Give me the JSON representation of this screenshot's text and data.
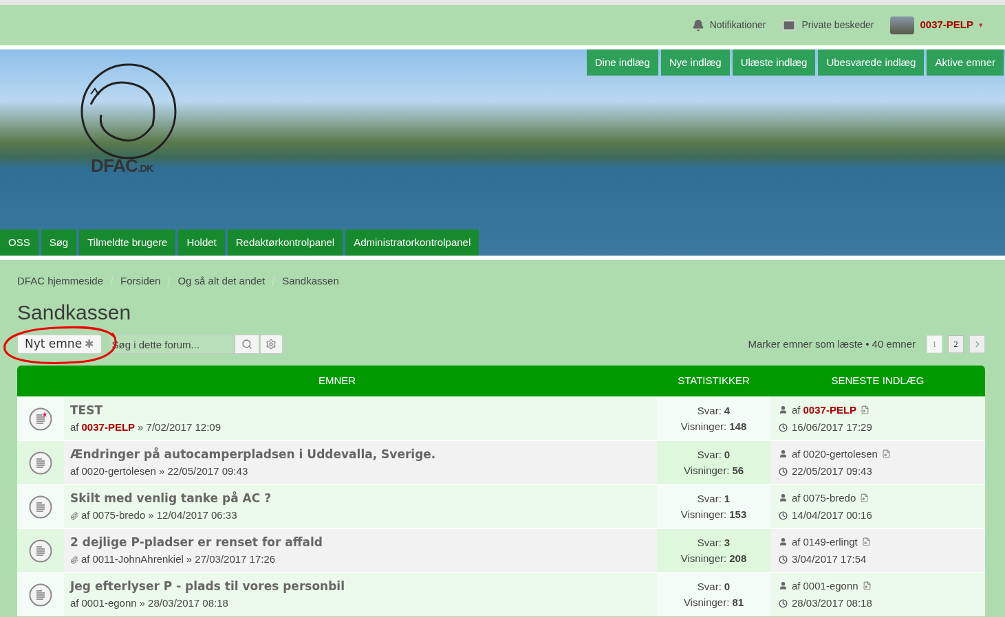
{
  "top_bar": {
    "notifications": "Notifikationer",
    "messages": "Private beskeder",
    "user": {
      "name": "0037-PELP",
      "caret": "▾"
    }
  },
  "banner": {
    "logo_text": "DFAC",
    "logo_suffix": ".DK",
    "quick_links": [
      {
        "label": "Dine indlæg"
      },
      {
        "label": "Nye indlæg"
      },
      {
        "label": "Ulæste indlæg"
      },
      {
        "label": "Ubesvarede indlæg"
      },
      {
        "label": "Aktive emner"
      }
    ],
    "nav": [
      {
        "label": "OSS"
      },
      {
        "label": "Søg"
      },
      {
        "label": "Tilmeldte brugere"
      },
      {
        "label": "Holdet"
      },
      {
        "label": "Redaktørkontrolpanel"
      },
      {
        "label": "Administratorkontrolpanel"
      }
    ]
  },
  "breadcrumbs": [
    "DFAC hjemmeside",
    "Forsiden",
    "Og så alt det andet",
    "Sandkassen"
  ],
  "title": "Sandkassen",
  "toolbar": {
    "new_topic": "Nyt emne",
    "new_topic_mark": "✱",
    "search": {
      "placeholder": "Søg i dette forum..."
    },
    "mark_read": "Marker emner som læste",
    "count": "• 40 emner",
    "pages": [
      {
        "label": "1",
        "selected": true
      },
      {
        "label": "2",
        "selected": false
      }
    ]
  },
  "table": {
    "columns": [
      "EMNER",
      "STATISTIKKER",
      "SENESTE INDLÆG"
    ],
    "rows": [
      {
        "title": "TEST",
        "unread": true,
        "attachment": false,
        "by": "af",
        "author": "0037-PELP",
        "author_highlighted": true,
        "posted": "» 7/02/2017 12:09",
        "replies_label": "Svar:",
        "replies": "4",
        "views_label": "Visninger:",
        "views": "148",
        "last_by": "af",
        "last_author": "0037-PELP",
        "last_highlighted": true,
        "last_time": "16/06/2017 17:29"
      },
      {
        "title": "Ændringer på autocamperpladsen i Uddevalla, Sverige.",
        "unread": false,
        "attachment": false,
        "by": "af",
        "author": "0020-gertolesen",
        "author_highlighted": false,
        "posted": "» 22/05/2017 09:43",
        "replies_label": "Svar:",
        "replies": "0",
        "views_label": "Visninger:",
        "views": "56",
        "last_by": "af",
        "last_author": "0020-gertolesen",
        "last_highlighted": false,
        "last_time": "22/05/2017 09:43"
      },
      {
        "title": "Skilt med venlig tanke på AC ?",
        "unread": false,
        "attachment": true,
        "by": "af",
        "author": "0075-bredo",
        "author_highlighted": false,
        "posted": "» 12/04/2017 06:33",
        "replies_label": "Svar:",
        "replies": "1",
        "views_label": "Visninger:",
        "views": "153",
        "last_by": "af",
        "last_author": "0075-bredo",
        "last_highlighted": false,
        "last_time": "14/04/2017 00:16"
      },
      {
        "title": "2 dejlige P-pladser er renset for affald",
        "unread": false,
        "attachment": true,
        "by": "af",
        "author": "0011-JohnAhrenkiel",
        "author_highlighted": false,
        "posted": "» 27/03/2017 17:26",
        "replies_label": "Svar:",
        "replies": "3",
        "views_label": "Visninger:",
        "views": "208",
        "last_by": "af",
        "last_author": "0149-erlingt",
        "last_highlighted": false,
        "last_time": "3/04/2017 17:54"
      },
      {
        "title": "Jeg efterlyser P - plads til vores personbil",
        "unread": false,
        "attachment": false,
        "by": "af",
        "author": "0001-egonn",
        "author_highlighted": false,
        "posted": "» 28/03/2017 08:18",
        "replies_label": "Svar:",
        "replies": "0",
        "views_label": "Visninger:",
        "views": "81",
        "last_by": "af",
        "last_author": "0001-egonn",
        "last_highlighted": false,
        "last_time": "28/03/2017 08:18"
      }
    ]
  }
}
